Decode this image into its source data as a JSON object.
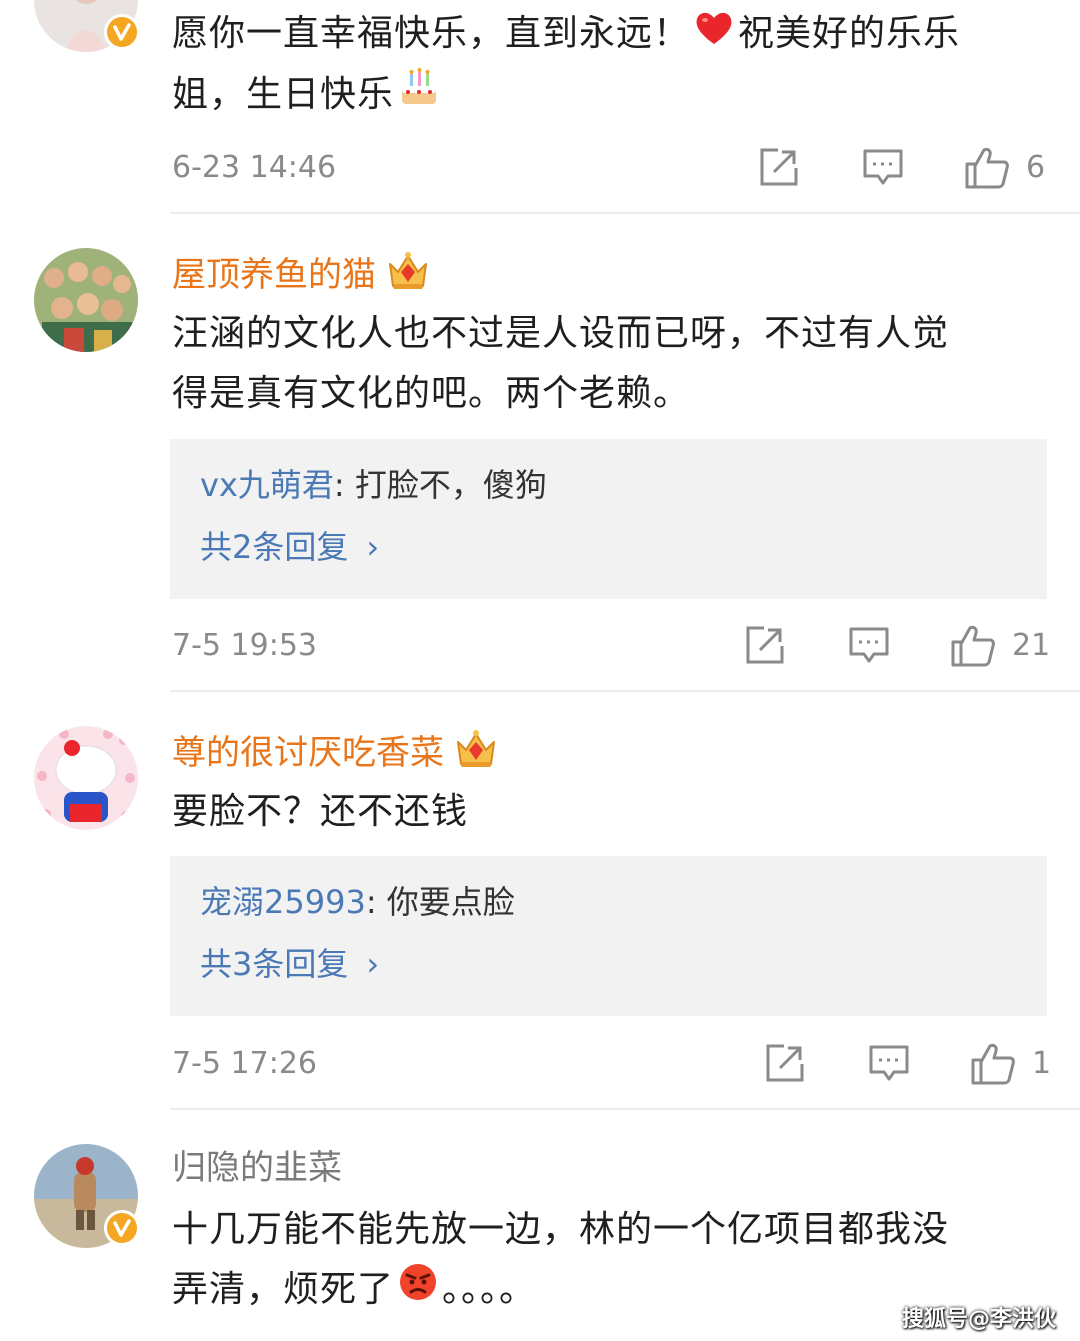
{
  "comments": [
    {
      "text_line1": "愿你一直幸福快乐，直到永远！",
      "text_line1b": "祝美好的乐乐",
      "text_line2": "姐，生日快乐",
      "time": "6-23 14:46",
      "likes": "6"
    },
    {
      "username": "屋顶养鱼的猫",
      "text_line1": "汪涵的文化人也不过是人设而已呀，不过有人觉",
      "text_line2": "得是真有文化的吧。两个老赖。",
      "reply_user": "vx九萌君",
      "reply_text": ": 打脸不，傻狗",
      "reply_more": "共2条回复",
      "time": "7-5 19:53",
      "likes": "21"
    },
    {
      "username": "尊的很讨厌吃香菜",
      "text_line1": "要脸不？还不还钱",
      "reply_user": "宠溺25993",
      "reply_text": ": 你要点脸",
      "reply_more": "共3条回复",
      "time": "7-5 17:26",
      "likes": "1"
    },
    {
      "username": "归隐的韭菜",
      "text_line1": "十几万能不能先放一边，林的一个亿项目都我没",
      "text_line2": "弄清，烦死了",
      "text_line2b": "。。。。"
    }
  ],
  "ui": {
    "reply_chevron": "›"
  },
  "watermark": "搜狐号@李洪伙",
  "colors": {
    "username": "#e8751a",
    "reply_link": "#4a79b5",
    "reply_bg": "#f2f2f2",
    "meta": "#8a8a8a",
    "verified_badge": "#f5a623"
  },
  "icons": [
    "verified-icon",
    "heart-emoji",
    "cake-emoji",
    "crown-icon",
    "share-icon",
    "comment-icon",
    "like-icon",
    "angry-emoji"
  ]
}
